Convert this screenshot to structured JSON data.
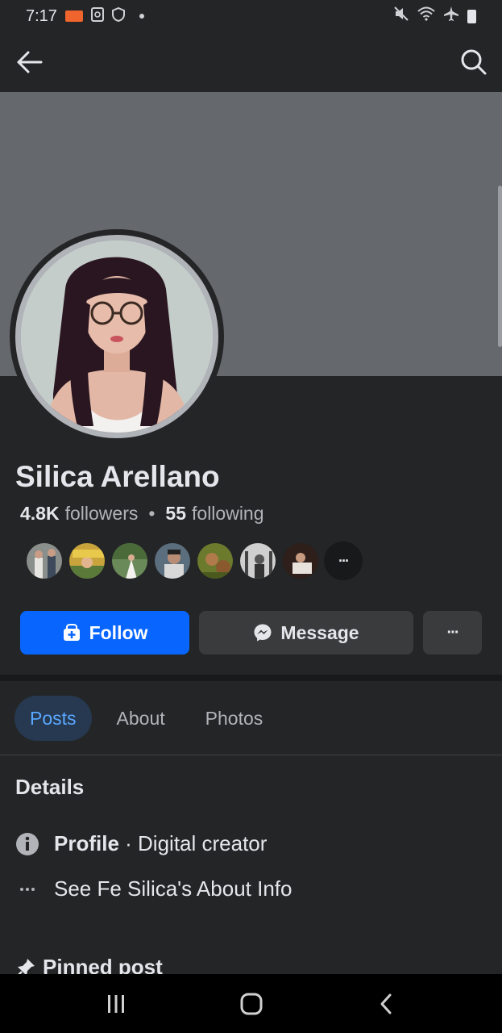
{
  "status_bar": {
    "time": "7:17",
    "left_icons": [
      "video-record-icon",
      "screenshot-icon",
      "shield-icon",
      "dot-icon"
    ],
    "right_icons": [
      "mute-icon",
      "wifi-icon",
      "airplane-icon",
      "battery-icon"
    ]
  },
  "header": {
    "back_icon": "arrow-left-icon",
    "search_icon": "search-icon"
  },
  "profile": {
    "name": "Silica Arellano",
    "followers_count": "4.8K",
    "followers_label": "followers",
    "separator": "•",
    "following_count": "55",
    "following_label": "following",
    "friend_avatars": [
      "friend-1",
      "friend-2",
      "friend-3",
      "friend-4",
      "friend-5",
      "friend-6",
      "friend-7"
    ],
    "more_friends_glyph": "···"
  },
  "actions": {
    "follow_label": "Follow",
    "message_label": "Message",
    "more_glyph": "···"
  },
  "tabs": [
    {
      "label": "Posts",
      "active": true
    },
    {
      "label": "About",
      "active": false
    },
    {
      "label": "Photos",
      "active": false
    }
  ],
  "details": {
    "heading": "Details",
    "profile_label": "Profile",
    "profile_value": " · Digital creator",
    "about_link": "See Fe Silica's About Info"
  },
  "pinned": {
    "label": "Pinned post"
  },
  "colors": {
    "background": "#242526",
    "cover": "#65686d",
    "accent_blue": "#0866ff",
    "active_tab_bg": "#263951",
    "active_tab_text": "#5aa7ff",
    "button_grey": "#3a3b3c"
  }
}
